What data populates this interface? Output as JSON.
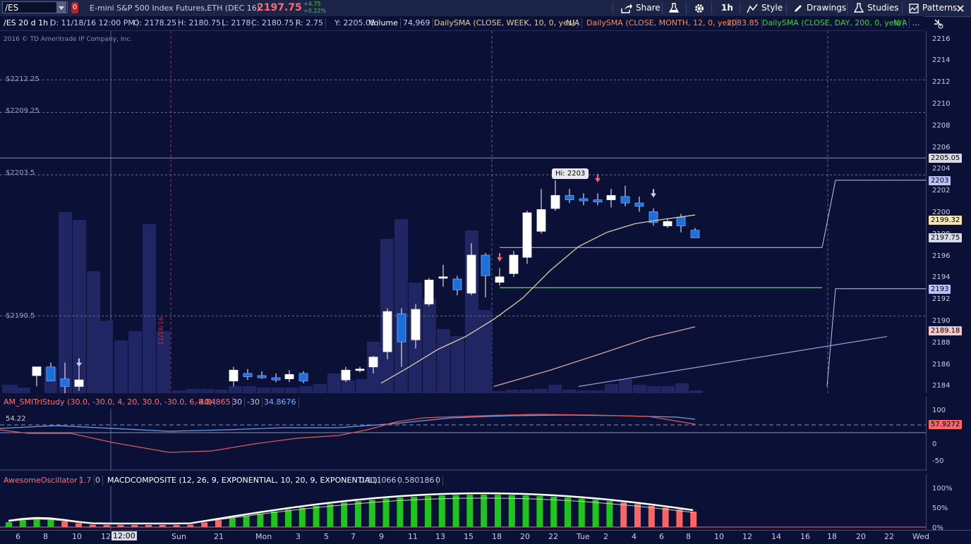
{
  "toolbar": {
    "symbol": "/ES",
    "badge": "0",
    "description": "E-mini S&P 500 Index Futures,ETH (DEC 16)",
    "last_price": "2197.75",
    "change_abs": "+4.75",
    "change_pct": "+0.22%",
    "share": "Share",
    "interval": "1h",
    "style": "Style",
    "drawings": "Drawings",
    "studies": "Studies",
    "patterns": "Patterns"
  },
  "info_bar": {
    "period": "/ES 20 d 1h",
    "date": "D: 11/18/16 12:00 PM",
    "open": "O: 2178.25",
    "high": "H: 2180.75",
    "low": "L: 2178",
    "close": "C: 2180.75",
    "range": "R: 2.75",
    "y": "Y: 2205.05",
    "volume_label": "Volume",
    "volume_value": "74,969",
    "sma_week": "DailySMA (CLOSE, WEEK, 10, 0, yes)",
    "sma_week_val": "N/A",
    "sma_month": "DailySMA (CLOSE, MONTH, 12, 0, yes)",
    "sma_month_val": "2083.85",
    "sma_day": "DailySMA (CLOSE, DAY, 200, 0, yes)",
    "sma_day_val": "N/A",
    "more": "...",
    "copyright": "2016 © TD Ameritrade IP Company, Inc."
  },
  "price_levels": [
    {
      "label": "$2212.25"
    },
    {
      "label": "$2209.25"
    },
    {
      "label": "$2203.5"
    },
    {
      "label": "$2190.5"
    }
  ],
  "hi_bubble": "Hi: 2203",
  "date_marker": "11/18/16",
  "price_axis": [
    "2216",
    "2214",
    "2212",
    "2210",
    "2208",
    "2206",
    "2204",
    "2202",
    "2200",
    "2198",
    "2196",
    "2194",
    "2192",
    "2190",
    "2188",
    "2186",
    "2184"
  ],
  "axis_tags": [
    {
      "text": "2205.05",
      "bg": "#d8dbe6",
      "fg": "#000000"
    },
    {
      "text": "2203",
      "bg": "#b9c2ff",
      "fg": "#000000"
    },
    {
      "text": "2199.32",
      "bg": "#f3e6b0",
      "fg": "#000000"
    },
    {
      "text": "2197.75",
      "bg": "#d8dbe6",
      "fg": "#000000"
    },
    {
      "text": "2193",
      "bg": "#b9c2ff",
      "fg": "#000000"
    },
    {
      "text": "2189.18",
      "bg": "#f3c8c8",
      "fg": "#000000"
    }
  ],
  "smi": {
    "name": "AM_SMITriStudy (30.0, -30.0, 4, 20, 30.0, -30.0, 6, 40)",
    "v1": "-8.84865",
    "v2": "30",
    "v3": "-30",
    "v4": "34.8676",
    "left_value": "54.22",
    "axis": [
      "100",
      "50",
      "0",
      "-50"
    ],
    "tag": "57.9272"
  },
  "macd": {
    "ao": "AwesomeOscillator",
    "ao_v1": "1.7",
    "ao_v2": "0",
    "name": "MACDCOMPOSITE (12, 26, 9, EXPONENTIAL, 10, 20, 9, EXPONENTIAL)",
    "v1": "0.111066",
    "v2": "0.580186",
    "v3": "0",
    "axis": [
      "100%",
      "50%",
      "0%"
    ]
  },
  "time_axis": [
    "6",
    "8",
    "10",
    "12",
    "12:00",
    "Sun",
    "21",
    "Mon",
    "3",
    "5",
    "7",
    "9",
    "11",
    "13",
    "15",
    "18",
    "20",
    "22",
    "Tue",
    "2",
    "4",
    "6",
    "8",
    "10",
    "12",
    "14",
    "16",
    "18",
    "20",
    "22",
    "Wed"
  ],
  "colors": {
    "up": "#ffffff",
    "down": "#1e6fd9",
    "volume": "#1f2663",
    "sma_short": "#d8cfa4",
    "sma_long": "#d9a6a6",
    "trend": "#9aa0e0",
    "macd_up": "#1dc51d",
    "macd_down": "#ff6464"
  }
}
